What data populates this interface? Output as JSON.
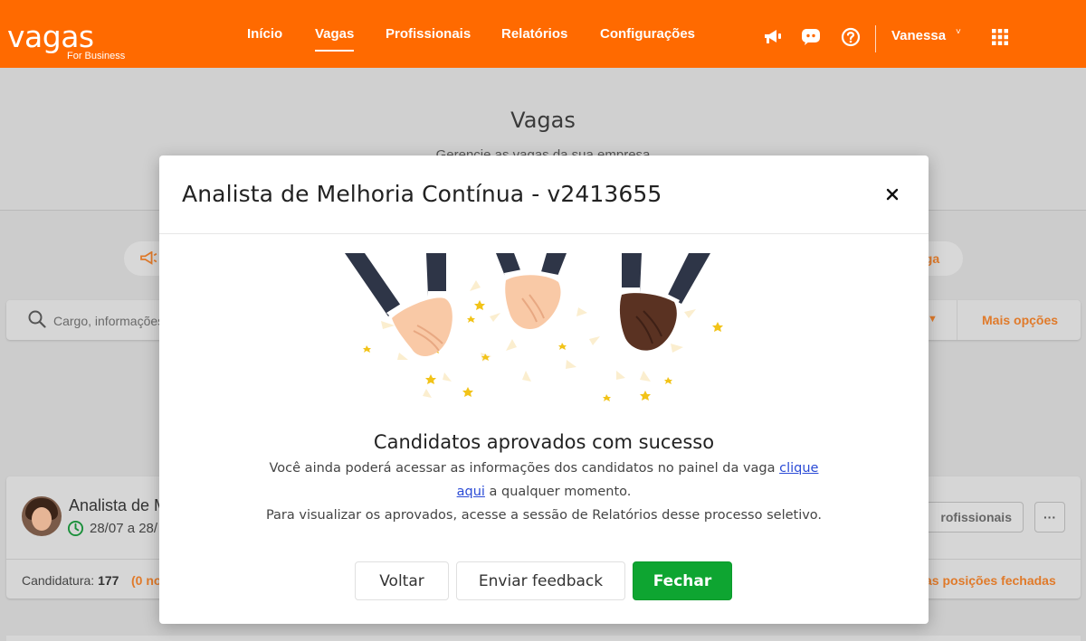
{
  "header": {
    "logo_text": "vagas",
    "logo_sub": "For Business",
    "nav": [
      {
        "label": "Início"
      },
      {
        "label": "Vagas"
      },
      {
        "label": "Profissionais"
      },
      {
        "label": "Relatórios"
      },
      {
        "label": "Configurações"
      }
    ],
    "active_nav": "Vagas",
    "user_name": "Vanessa",
    "brand_color": "#ff6a00"
  },
  "page": {
    "title": "Vagas",
    "subtitle": "Gerencie as vagas da sua empresa",
    "right_pill_label": "aga",
    "search_placeholder": "Cargo, informações",
    "more_options_label": "Mais opções"
  },
  "job_card": {
    "title": "Analista de M",
    "date": "28/07 a 28/",
    "profissionais_label": "rofissionais",
    "more_label": "···",
    "candidatura_label": "Candidatura:",
    "candidatura_count": "177",
    "candidatura_extra": "(0 no",
    "closed_positions_label": "as posições fechadas"
  },
  "modal": {
    "title": "Analista de Melhoria Contínua - v2413655",
    "success_title": "Candidatos aprovados com sucesso",
    "desc_1_prefix": "Você ainda poderá acessar as informações dos candidatos no painel da vaga ",
    "desc_1_link_a": "clique",
    "desc_1_link_b": "aqui",
    "desc_1_suffix": " a qualquer momento.",
    "desc_2": "Para visualizar os aprovados, acesse a sessão de Relatórios desse processo seletivo.",
    "buttons": {
      "back": "Voltar",
      "feedback": "Enviar feedback",
      "close": "Fechar"
    },
    "close_button_color": "#0ea531"
  }
}
